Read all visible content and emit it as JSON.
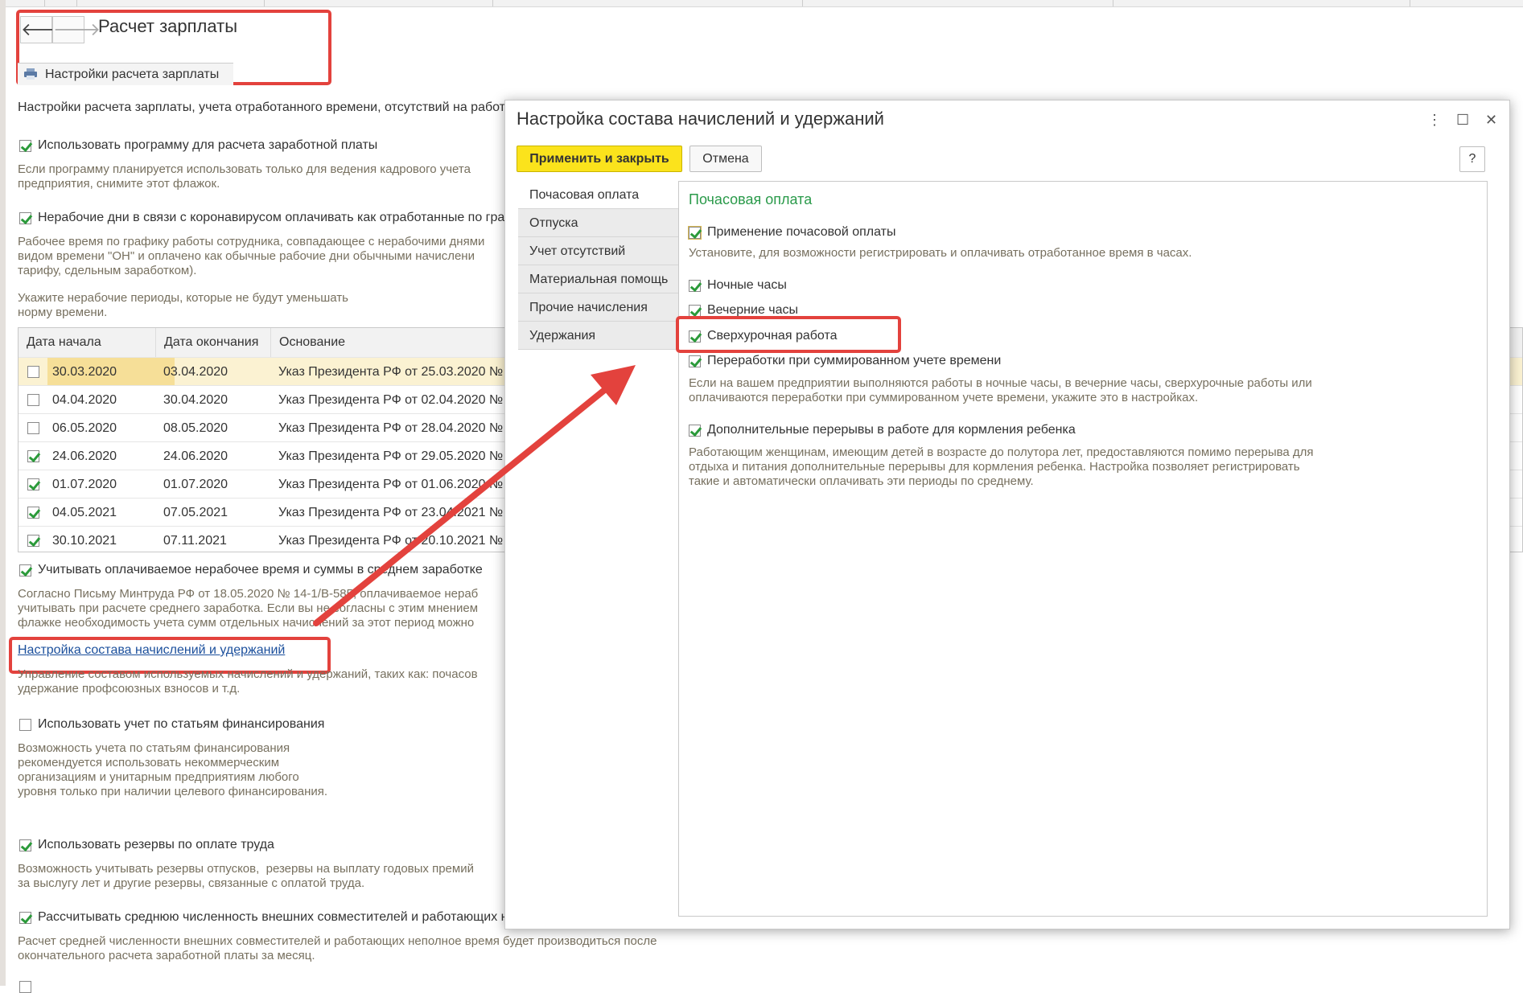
{
  "main": {
    "title": "Расчет зарплаты",
    "settings_tab": "Настройки расчета зарплаты",
    "intro": "Настройки расчета зарплаты, учета отработанного времени, отсутствий на работ",
    "opt_use_program": "Использовать программу для расчета заработной платы",
    "opt_use_program_hint": "Если программу планируется использовать только для ведения кадрового учета\nпредприятия, снимите этот флажок.",
    "opt_covid": "Нерабочие дни в связи с коронавирусом оплачивать как отработанные по гра",
    "opt_covid_hint": "Рабочее время по графику работы сотрудника, совпадающее с нерабочими днями\nвидом времени \"ОН\" и оплачено как обычные рабочие дни обычными начислени\nтарифу, сдельным заработком).",
    "periods_hint": "Укажите нерабочие периоды, которые не будут уменьшать\nнорму времени.",
    "table": {
      "headers": [
        "Дата начала",
        "Дата окончания",
        "Основание"
      ],
      "rows": [
        {
          "checked": false,
          "start": "30.03.2020",
          "end": "03.04.2020",
          "reason": "Указ Президента РФ от 25.03.2020 №"
        },
        {
          "checked": false,
          "start": "04.04.2020",
          "end": "30.04.2020",
          "reason": "Указ Президента РФ от 02.04.2020 №"
        },
        {
          "checked": false,
          "start": "06.05.2020",
          "end": "08.05.2020",
          "reason": "Указ Президента РФ от 28.04.2020 №"
        },
        {
          "checked": true,
          "start": "24.06.2020",
          "end": "24.06.2020",
          "reason": "Указ Президента РФ от 29.05.2020 №"
        },
        {
          "checked": true,
          "start": "01.07.2020",
          "end": "01.07.2020",
          "reason": "Указ Президента РФ от 01.06.2020 №"
        },
        {
          "checked": true,
          "start": "04.05.2021",
          "end": "07.05.2021",
          "reason": "Указ Президента РФ от 23.04.2021 №"
        },
        {
          "checked": true,
          "start": "30.10.2021",
          "end": "07.11.2021",
          "reason": "Указ Президента РФ от 20.10.2021 №"
        }
      ]
    },
    "opt_avg": "Учитывать оплачиваемое нерабочее время и суммы в среднем заработке",
    "opt_avg_hint": "Согласно Письму Минтруда РФ от 18.05.2020 № 14-1/В-585, оплачиваемое нераб\nучитывать при расчете среднего заработка. Если вы не согласны с этим мнением\nфлажке необходимость учета сумм отдельных начислений за этот период можно",
    "link_accruals": "Настройка состава начислений и удержаний",
    "link_accruals_hint": "Управление составом используемых начислений и удержаний, таких как: почасов\nудержание профсоюзных взносов и т.д.",
    "opt_financing": "Использовать учет по статьям финансирования",
    "opt_financing_hint": "Возможность учета по статьям финансирования\nрекомендуется использовать некоммерческим\nорганизациям и унитарным предприятиям любого\nуровня только при наличии целевого финансирования.",
    "opt_reserves": "Использовать резервы по оплате труда",
    "opt_reserves_hint": "Возможность учитывать резервы отпусков,  резервы на выплату годовых премий\nза выслугу лет и другие резервы, связанные с оплатой труда.",
    "opt_avg_count": "Рассчитывать среднюю численность внешних совместителей и работающих н",
    "opt_avg_count_hint": "Расчет средней численности внешних совместителей и работающих неполное время будет производиться после\nокончательного расчета заработной платы за месяц."
  },
  "modal": {
    "title": "Настройка состава начислений и удержаний",
    "apply_label": "Применить и закрыть",
    "cancel_label": "Отмена",
    "help_label": "?",
    "more_icon": "⋮",
    "maximize_icon": "☐",
    "close_icon": "✕",
    "tabs": [
      "Почасовая оплата",
      "Отпуска",
      "Учет отсутствий",
      "Материальная помощь",
      "Прочие начисления",
      "Удержания"
    ],
    "section_title": "Почасовая оплата",
    "opt_hourly": "Применение почасовой оплаты",
    "opt_hourly_hint": "Установите, для возможности регистрировать и оплачивать отработанное время в часах.",
    "opt_night": "Ночные часы",
    "opt_evening": "Вечерние часы",
    "opt_overtime": "Сверхурочная работа",
    "opt_summary": "Переработки при суммированном учете времени",
    "opt_summary_hint": "Если на вашем предприятии выполняются работы в ночные часы, в вечерние часы, сверхурочные работы или\nоплачиваются переработки при суммированном учете времени, укажите это в настройках.",
    "opt_breaks": "Дополнительные перерывы в работе для кормления ребенка",
    "opt_breaks_hint": "Работающим женщинам, имеющим детей в возрасте до полутора лет, предоставляются помимо перерыва для\nотдыха и питания дополнительные перерывы для кормления ребенка. Настройка позволяет регистрировать\nтакие и автоматически оплачивать эти периоды по среднему."
  },
  "colors": {
    "accent_red": "#e3423d",
    "apply_yellow": "#fbe31c",
    "section_green": "#2a9a4a",
    "link_blue": "#1b4f9c"
  },
  "icons": [
    "back-arrow-icon",
    "forward-arrow-icon",
    "printer-icon",
    "more-icon",
    "maximize-icon",
    "close-icon",
    "checkbox-icon"
  ]
}
